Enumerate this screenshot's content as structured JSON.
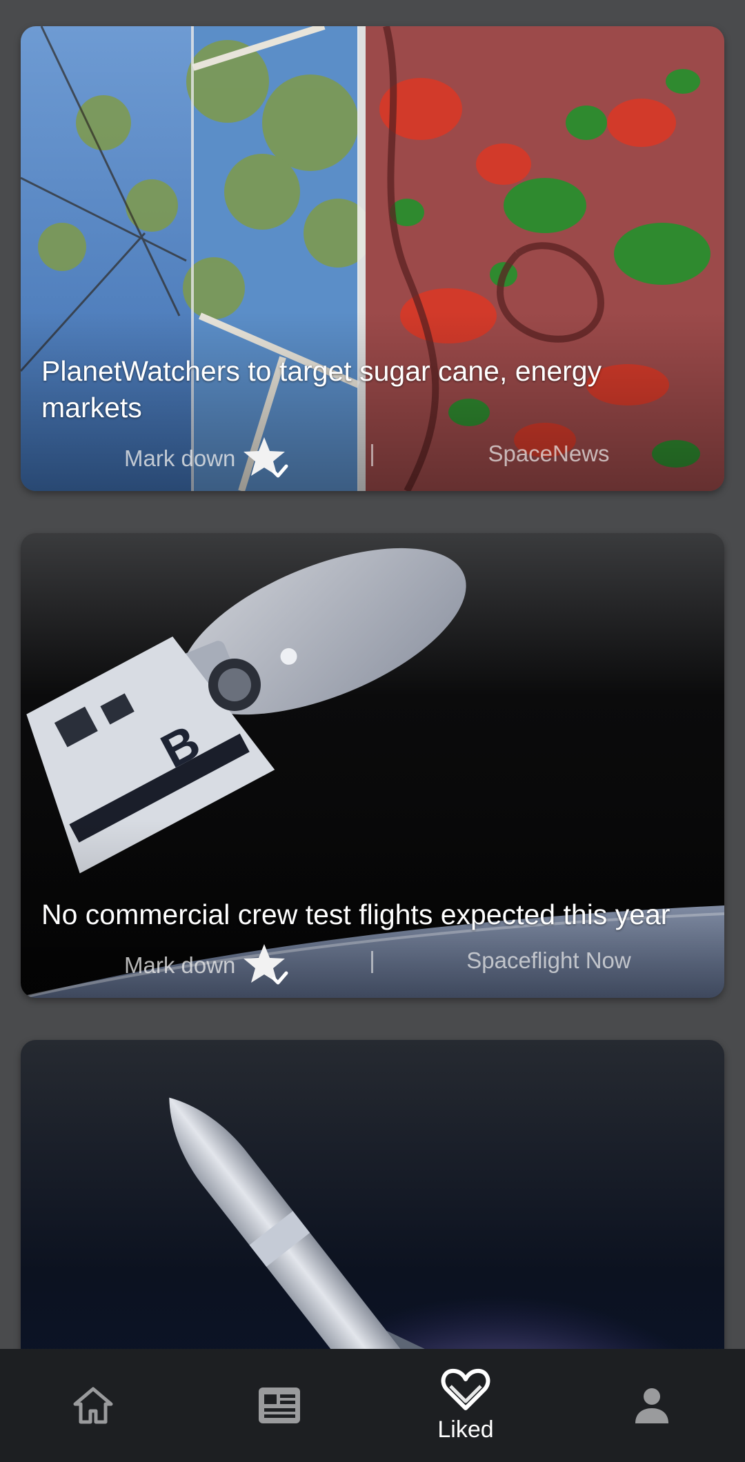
{
  "feed": {
    "articles": [
      {
        "title": "PlanetWatchers to target sugar cane, energy markets",
        "mark_label": "Mark down",
        "source": "SpaceNews"
      },
      {
        "title": "No commercial crew test flights expected this year",
        "mark_label": "Mark down",
        "source": "Spaceflight Now"
      }
    ]
  },
  "bottom_nav": {
    "items": [
      {
        "icon": "home-icon"
      },
      {
        "icon": "news-icon"
      },
      {
        "icon": "heart-icon",
        "label": "Liked"
      },
      {
        "icon": "person-icon"
      }
    ],
    "active_color": "#ffffff",
    "inactive_color": "#9a9b9d"
  }
}
